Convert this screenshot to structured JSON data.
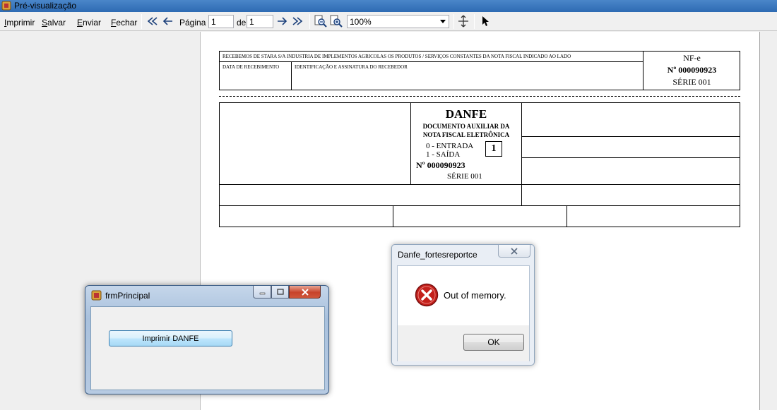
{
  "window": {
    "title": "Pré-visualização"
  },
  "menu": [
    {
      "label": "Imprimir",
      "accel": "I",
      "rest": "mprimir"
    },
    {
      "label": "Salvar",
      "accel": "S",
      "rest": "alvar"
    },
    {
      "label": "Enviar",
      "accel": "E",
      "rest": "nviar"
    },
    {
      "label": "Fechar",
      "accel": "F",
      "rest": "echar"
    }
  ],
  "toolbar": {
    "page_label": "Página",
    "page_value": "1",
    "of_label": "de",
    "total_value": "1",
    "zoom_value": "100%"
  },
  "danfe": {
    "receipt_text": "RECEBEMOS DE STARA S/A INDUSTRIA DE IMPLEMENTOS AGRICOLAS OS PRODUTOS / SERVIÇOS CONSTANTES DA NOTA FISCAL INDICADO AO LADO",
    "date_label": "DATA DE RECEBIMENTO",
    "signature_label": "IDENTIFICAÇÃO E ASSINATURA DO RECEBEDOR",
    "nfe_label": "NF-e",
    "number": "Nº 000090923",
    "series": "SÉRIE 001",
    "title": "DANFE",
    "subtitle_1": "DOCUMENTO AUXILIAR DA",
    "subtitle_2": "NOTA FISCAL ELETRÔNICA",
    "entry_label": "0 - ENTRADA",
    "exit_label": "1 - SAÍDA",
    "type_value": "1"
  },
  "frm_principal": {
    "title": "frmPrincipal",
    "button_label": "Imprimir DANFE"
  },
  "dialog": {
    "title": "Danfe_fortesreportce",
    "message": "Out of memory.",
    "ok_label": "OK"
  },
  "colors": {
    "titlebar": "#2e6bb3",
    "error": "#c4201b",
    "accent_button": "#3c7fb1"
  }
}
